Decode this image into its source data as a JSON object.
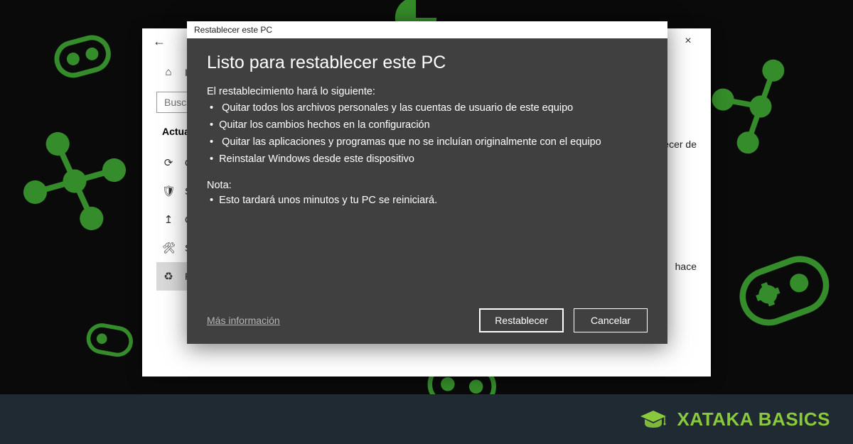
{
  "background": {
    "base_color": "#0a0a0a",
    "accent_color": "#3a9b2e"
  },
  "settings_window": {
    "back_icon": "←",
    "close_icon": "×",
    "home_label": "Inicio",
    "search_placeholder": "Buscar",
    "section_heading": "Actualización y seguridad",
    "nav_items": [
      {
        "icon": "⟳",
        "label": "Opciones"
      },
      {
        "icon": "🛡",
        "label": "Seguridad"
      },
      {
        "icon": "↥",
        "label": "Copia"
      },
      {
        "icon": "🛠",
        "label": "Solucionar"
      },
      {
        "icon": "♻",
        "label": "Recuperación"
      }
    ],
    "content_hint_right_1": "Restablecer de",
    "content_hint_right_2": "hace",
    "content_link": "Más información"
  },
  "modal": {
    "titlebar": "Restablecer este PC",
    "heading": "Listo para restablecer este PC",
    "intro": "El restablecimiento hará lo siguiente:",
    "bullets": [
      " Quitar todos los archivos personales y las cuentas de usuario de este equipo",
      "Quitar los cambios hechos en la configuración",
      " Quitar las aplicaciones y programas que no se incluían originalmente con el equipo",
      "Reinstalar Windows desde este dispositivo"
    ],
    "note_label": "Nota:",
    "note_bullets": [
      "Esto tardará unos minutos y tu PC se reiniciará."
    ],
    "more_info": "Más información",
    "primary_button": "Restablecer",
    "secondary_button": "Cancelar"
  },
  "brand": {
    "text": "XATAKA BASICS",
    "logo_color": "#8ac83c"
  }
}
